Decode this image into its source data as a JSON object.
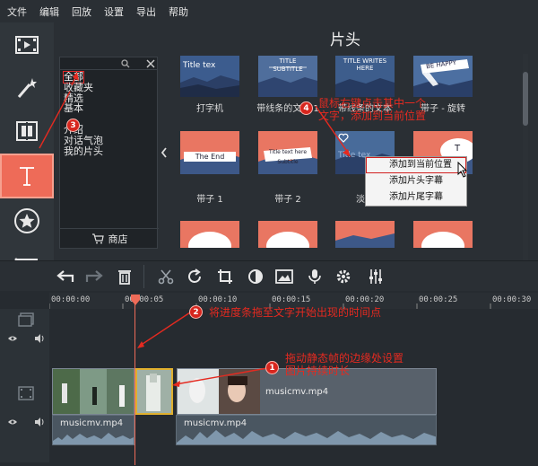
{
  "menu": [
    "文件",
    "编辑",
    "回放",
    "设置",
    "导出",
    "帮助"
  ],
  "gallery": {
    "title": "片头",
    "tiles": [
      {
        "label": "打字机",
        "thumb_text": "Title tex"
      },
      {
        "label": "带线条的文本 1",
        "thumb_text": "TITLE SUBTITLE"
      },
      {
        "label": "带线条的文本",
        "thumb_text": "TITLE WRITES HERE"
      },
      {
        "label": "带子 - 旋转",
        "thumb_text": "BE HAPPY"
      },
      {
        "label": "带子 1",
        "thumb_text": "The End"
      },
      {
        "label": "带子 2",
        "thumb_text": "Title text here Subtitle"
      },
      {
        "label": "淡出",
        "thumb_text": "Title tex"
      },
      {
        "label": "",
        "thumb_text": "T"
      }
    ]
  },
  "categories": {
    "items": [
      "全部",
      "收藏夹",
      "精选",
      "基本",
      "",
      "介绍",
      "对话气泡",
      "我的片头"
    ],
    "selected": "全部",
    "shop_label": "商店"
  },
  "context_menu": [
    "添加到当前位置",
    "添加片头字幕",
    "添加片尾字幕"
  ],
  "annotations": {
    "a1": "拖动静态帧的边缘处设置\n图片持续时长",
    "a2": "将进度条拖至文字开始出现的时间点",
    "a4": "鼠标右键点击其中一个\n文字，添加到当前位置",
    "badges": [
      "1",
      "2",
      "3",
      "4"
    ]
  },
  "timeline": {
    "ticks": [
      "00:00:00",
      "00:00:05",
      "00:00:10",
      "00:00:15",
      "00:00:20",
      "00:00:25",
      "00:00:30"
    ],
    "clip_name": "musicmv.mp4",
    "audio_name": "musicmv.mp4"
  },
  "colors": {
    "accent": "#ee6b58",
    "annotation": "#e52a20",
    "background": "#2a2f34"
  }
}
